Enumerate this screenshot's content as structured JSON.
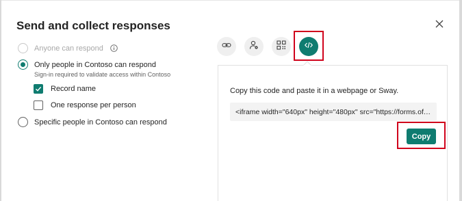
{
  "dialog": {
    "title": "Send and collect responses",
    "close_icon": "close-icon"
  },
  "options": {
    "anyone": {
      "label": "Anyone can respond",
      "checked": false,
      "disabled": true,
      "icon": "info-icon"
    },
    "only_people": {
      "label": "Only people in Contoso can respond",
      "checked": true,
      "sublabel": "Sign-in required to validate access within Contoso"
    },
    "record_name": {
      "label": "Record name",
      "checked": true
    },
    "one_response": {
      "label": "One response per person",
      "checked": false
    },
    "specific_people": {
      "label": "Specific people in Contoso can respond",
      "checked": false
    }
  },
  "share_methods": [
    {
      "icon": "link-icon",
      "active": false
    },
    {
      "icon": "person-settings-icon",
      "active": false
    },
    {
      "icon": "qr-code-icon",
      "active": false
    },
    {
      "icon": "embed-code-icon",
      "active": true
    }
  ],
  "embed": {
    "instruction": "Copy this code and paste it in a webpage or Sway.",
    "code": "<iframe width=\"640px\" height=\"480px\" src=\"https://forms.office...",
    "copy_label": "Copy"
  },
  "colors": {
    "accent": "#0f7c70",
    "highlight": "#d0021b"
  }
}
